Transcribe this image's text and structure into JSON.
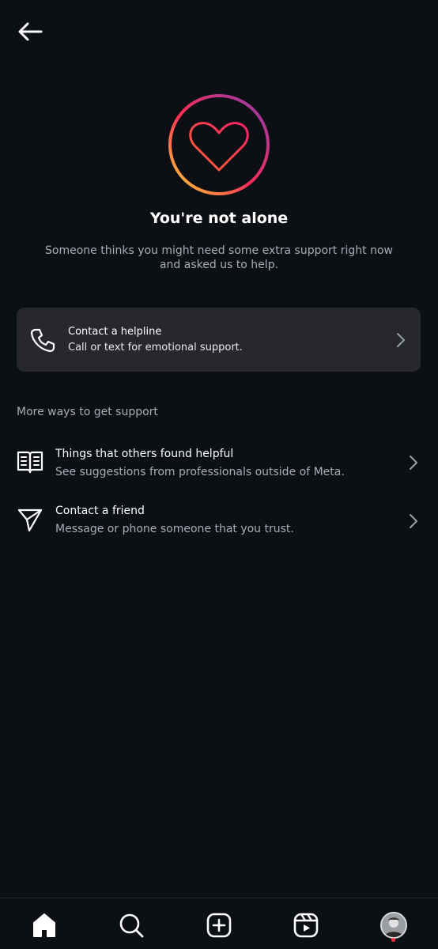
{
  "header": {
    "back_icon": "arrow-left-icon"
  },
  "hero": {
    "icon": "heart-in-gradient-circle-icon",
    "title": "You're not alone",
    "subtitle": "Someone thinks you might need some extra support right now and asked us to help."
  },
  "helpline": {
    "icon": "phone-icon",
    "title": "Contact a helpline",
    "subtitle": "Call or text for emotional support."
  },
  "more": {
    "label": "More ways to get support",
    "items": [
      {
        "icon": "book-icon",
        "title": "Things that others found helpful",
        "subtitle": "See suggestions from professionals outside of Meta."
      },
      {
        "icon": "paper-plane-icon",
        "title": "Contact a friend",
        "subtitle": "Message or phone someone that you trust."
      }
    ]
  },
  "nav": {
    "items": [
      "home-icon",
      "search-icon",
      "create-icon",
      "reels-icon",
      "profile-avatar"
    ]
  },
  "colors": {
    "background": "#0c0f14",
    "card": "#26282d",
    "secondary_text": "#a8aeb7",
    "gradient": [
      "#fdd835",
      "#ff2d55",
      "#c13584",
      "#833ab4"
    ],
    "notification_dot": "#ff3040"
  }
}
